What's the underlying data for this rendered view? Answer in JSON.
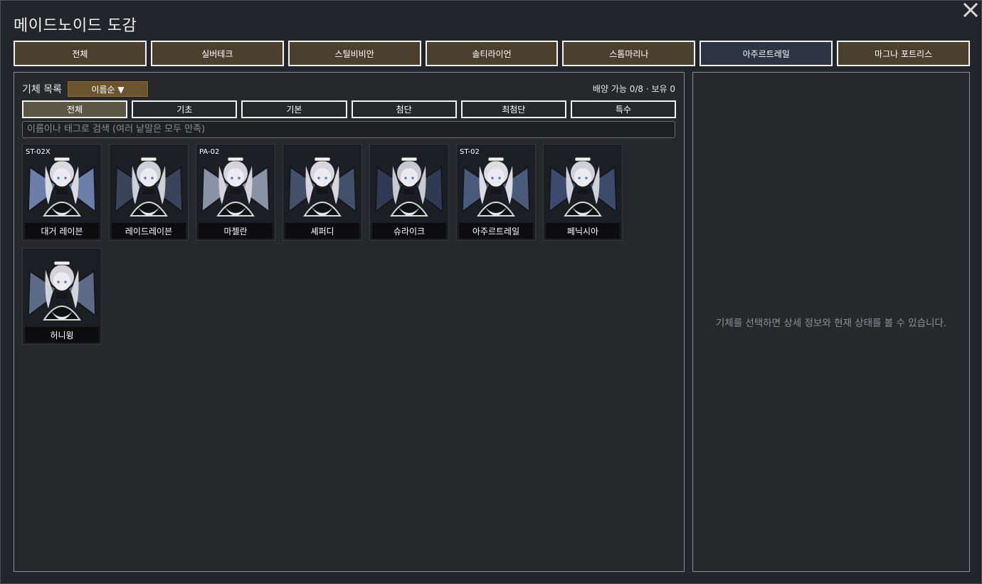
{
  "title": "메이드노이드 도감",
  "faction_tabs": [
    {
      "label": "전체",
      "active": false
    },
    {
      "label": "실버테크",
      "active": false
    },
    {
      "label": "스틸비비안",
      "active": false
    },
    {
      "label": "솔티라이언",
      "active": false
    },
    {
      "label": "스톰마리나",
      "active": false
    },
    {
      "label": "아주르트레일",
      "active": true
    },
    {
      "label": "마그나 포트리스",
      "active": false
    }
  ],
  "list": {
    "label": "기체 목록",
    "sort_label": "이름순 ▼",
    "deploy_info": "배양 가능 0/8 · 보유 0",
    "search_placeholder": "이름이나 태그로 검색 (여러 낱말은 모두 만족)"
  },
  "category_tabs": [
    {
      "label": "전체",
      "active": true
    },
    {
      "label": "기초",
      "active": false
    },
    {
      "label": "기본",
      "active": false
    },
    {
      "label": "첨단",
      "active": false
    },
    {
      "label": "최첨단",
      "active": false
    },
    {
      "label": "특수",
      "active": false
    }
  ],
  "units": [
    {
      "name": "대거 레이븐",
      "code": "ST-02X"
    },
    {
      "name": "레이드레이븐",
      "code": ""
    },
    {
      "name": "마젤란",
      "code": "PA-02"
    },
    {
      "name": "셰퍼디",
      "code": ""
    },
    {
      "name": "슈라이크",
      "code": ""
    },
    {
      "name": "아주르트레일",
      "code": "ST-02"
    },
    {
      "name": "페닉시아",
      "code": ""
    },
    {
      "name": "허니윙",
      "code": ""
    }
  ],
  "detail": {
    "empty_message": "기체를 선택하면 상세 정보와 현재 상태를 볼 수 있습니다."
  },
  "colors": {
    "faction_tab_bg": "#4b3f2e",
    "faction_tab_active_bg": "#2c3444",
    "category_tab_active_bg": "#5a5842",
    "sort_button_bg": "#6b5430"
  }
}
